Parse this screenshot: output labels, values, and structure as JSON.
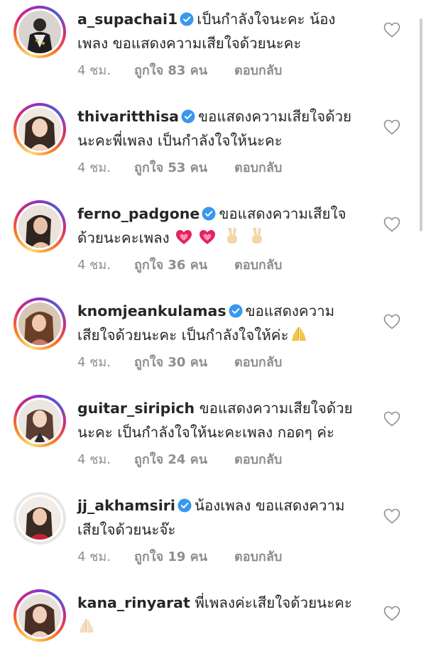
{
  "colors": {
    "text": "#262626",
    "secondary_text": "#8e8e8e",
    "verified_blue": "#3897f0",
    "story_ring_gradient": [
      "#feda75",
      "#fa7e1e",
      "#d62976",
      "#962fbf",
      "#4f5bd5"
    ],
    "heart_emoji": "#e0245e"
  },
  "comments": [
    {
      "username": "a_supachai1",
      "verified": true,
      "text_line1": "เป็นกำลังใจนะคะ น้อง",
      "text_line2": "เพลง ขอแสดงความเสียใจด้วยนะคะ",
      "time": "4 ชม.",
      "likes": "ถูกใจ 83 คน",
      "reply": "ตอบกลับ",
      "story_ring": true,
      "avatar_icon": "avatar-photo"
    },
    {
      "username": "thivaritthisa",
      "verified": true,
      "text_line1": "ขอแสดงความเสียใจด้วย",
      "text_line2": "นะคะพี่เพลง เป็นกำลังใจให้นะคะ",
      "time": "4 ชม.",
      "likes": "ถูกใจ 53 คน",
      "reply": "ตอบกลับ",
      "story_ring": true,
      "avatar_icon": "avatar-photo"
    },
    {
      "username": "ferno_padgone",
      "verified": true,
      "text_line1": "ขอแสดงความเสียใจ",
      "text_line2": "ด้วยนะคะเพลง",
      "emojis": [
        "heart-emoji",
        "heart-emoji",
        "victory-hand-emoji",
        "victory-hand-emoji"
      ],
      "time": "4 ชม.",
      "likes": "ถูกใจ 36 คน",
      "reply": "ตอบกลับ",
      "story_ring": true,
      "avatar_icon": "avatar-photo"
    },
    {
      "username": "knomjeankulamas",
      "verified": true,
      "text_line1": "ขอแสดงความ",
      "text_line2": "เสียใจด้วยนะคะ เป็นกำลังใจให้ค่ะ",
      "emojis": [
        "folded-hands-emoji"
      ],
      "time": "4 ชม.",
      "likes": "ถูกใจ 30 คน",
      "reply": "ตอบกลับ",
      "story_ring": true,
      "avatar_icon": "avatar-photo"
    },
    {
      "username": "guitar_siripich",
      "verified": false,
      "text_line1": "ขอแสดงความเสียใจด้วย",
      "text_line2": "นะคะ เป็นกำลังใจให้นะคะเพลง กอดๆ ค่ะ",
      "time": "4 ชม.",
      "likes": "ถูกใจ 24 คน",
      "reply": "ตอบกลับ",
      "story_ring": true,
      "avatar_icon": "avatar-photo"
    },
    {
      "username": "jj_akhamsiri",
      "verified": true,
      "text_line1": "น้องเพลง ขอแสดงความ",
      "text_line2": "เสียใจด้วยนะจ๊ะ",
      "time": "4 ชม.",
      "likes": "ถูกใจ 19 คน",
      "reply": "ตอบกลับ",
      "story_ring": false,
      "avatar_icon": "avatar-photo"
    },
    {
      "username": "kana_rinyarat",
      "verified": false,
      "text_line1": "พี่เพลงค่ะเสียใจด้วยนะคะ",
      "text_line2": "",
      "emojis_line2": [
        "folded-hands-emoji"
      ],
      "time": "",
      "likes": "",
      "reply": "",
      "story_ring": true,
      "avatar_icon": "avatar-photo"
    }
  ]
}
